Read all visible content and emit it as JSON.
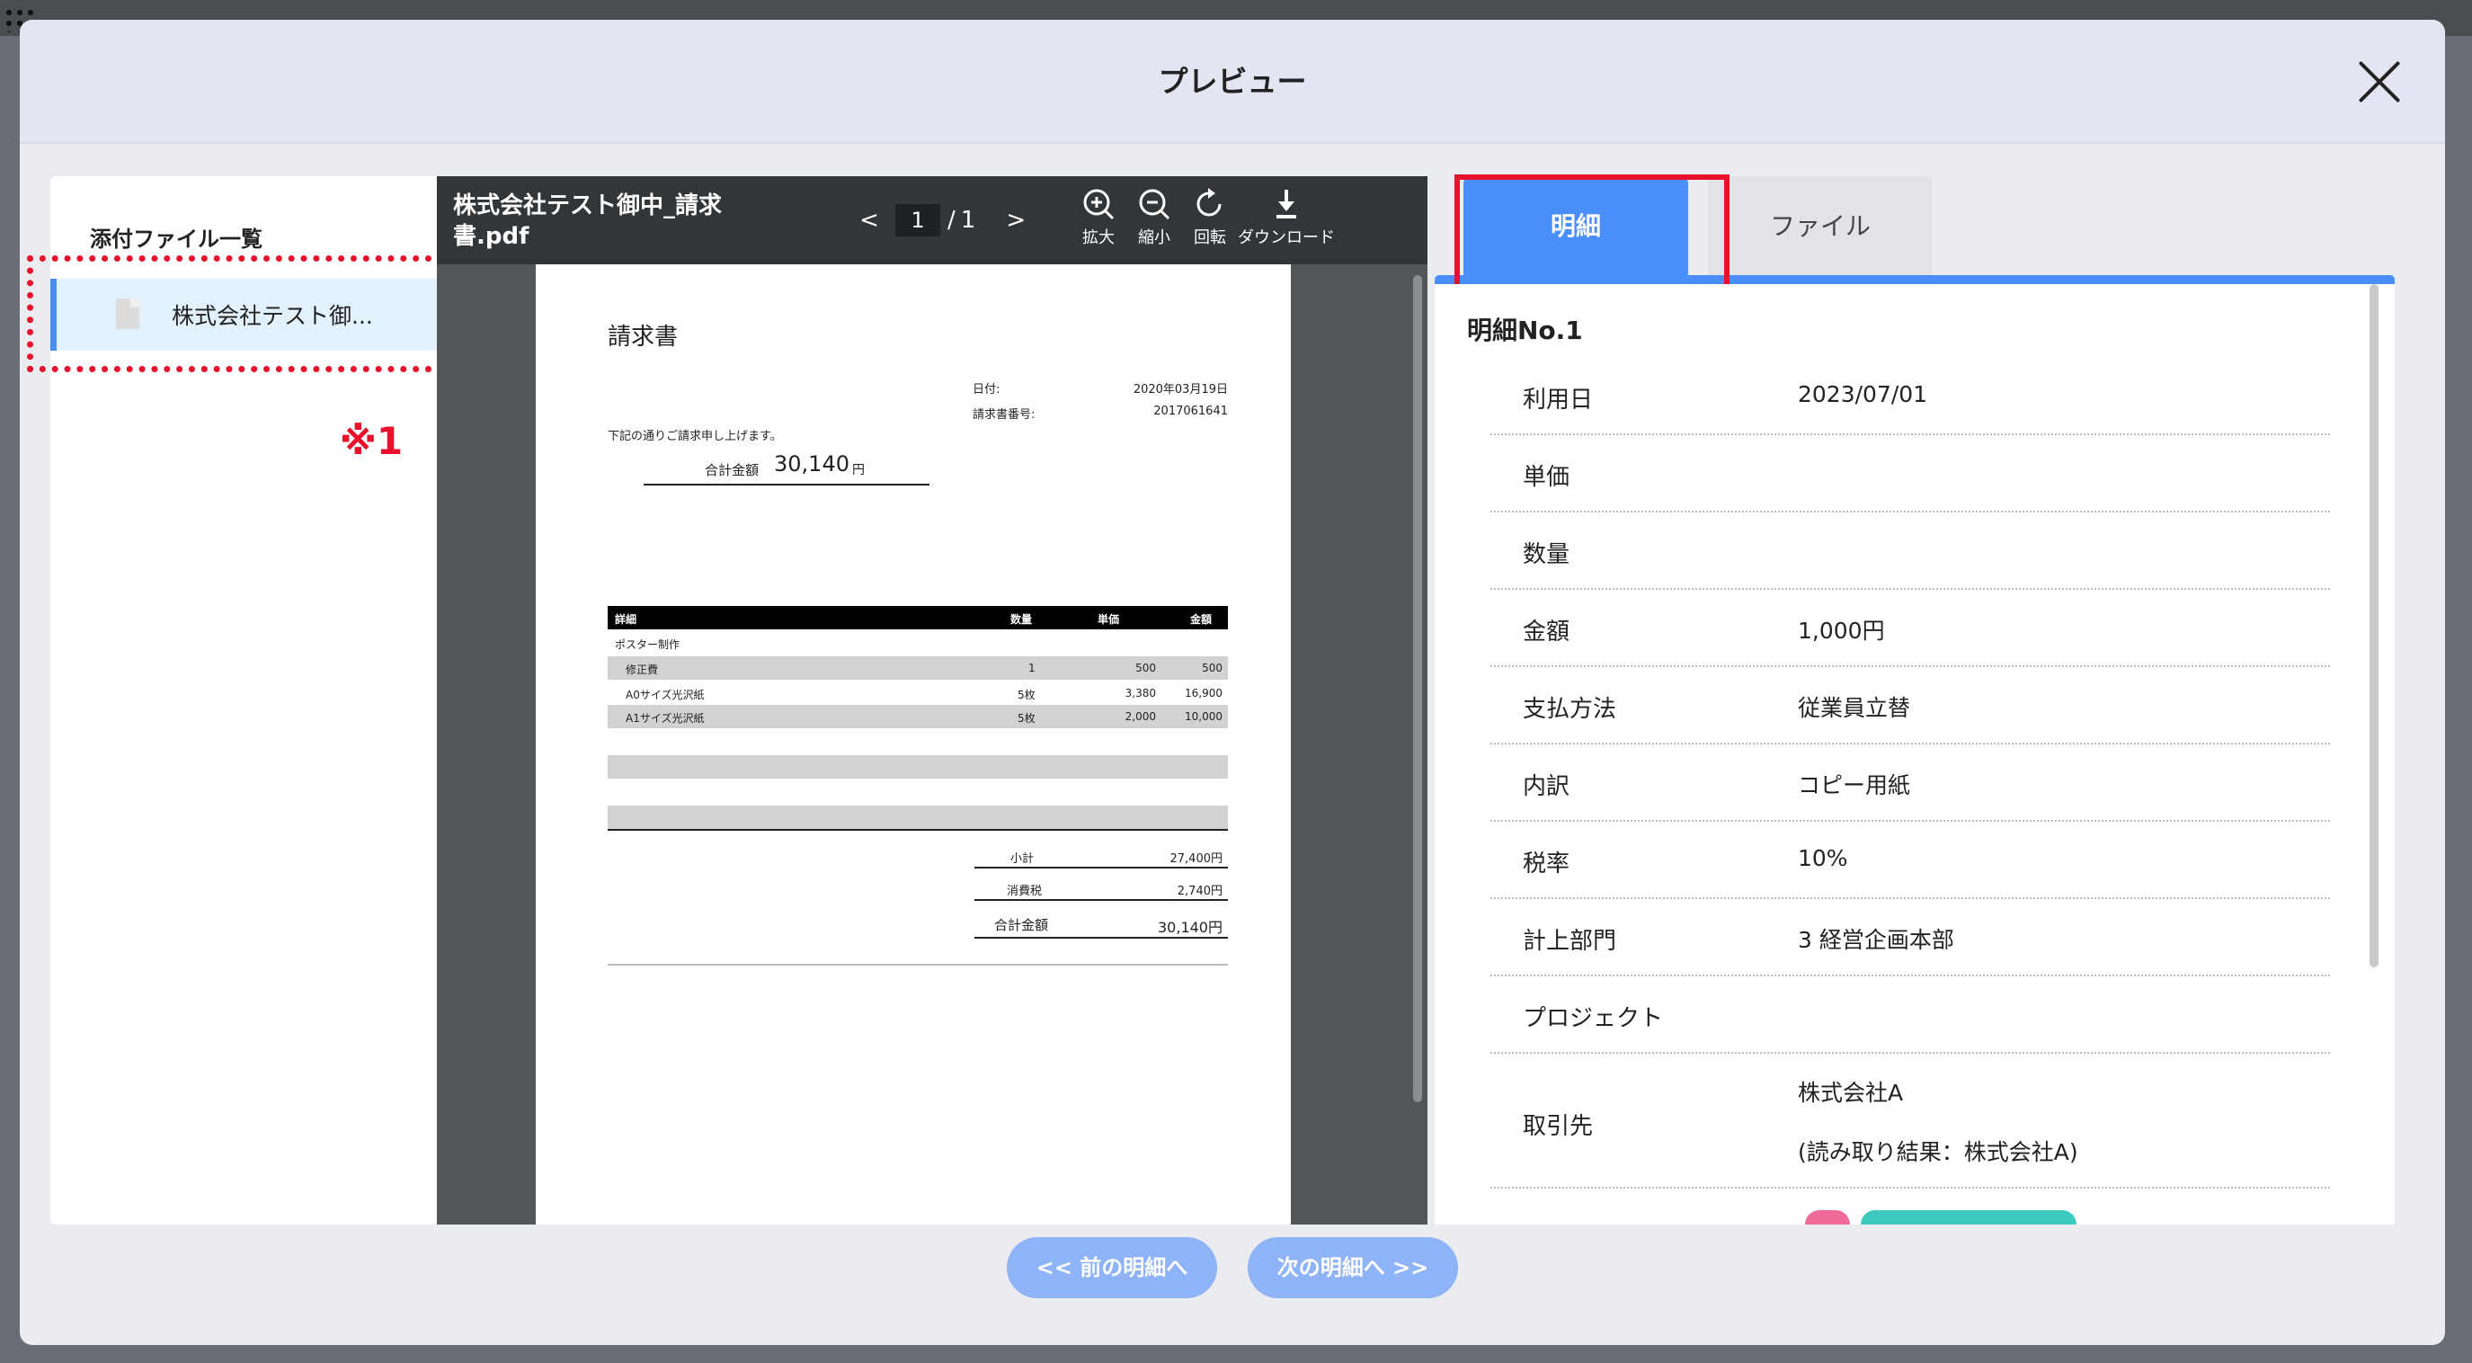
{
  "modal": {
    "title": "プレビュー"
  },
  "file_panel": {
    "title": "添付ファイル一覧",
    "files": [
      {
        "name": "株式会社テスト御..."
      }
    ],
    "note_mark": "※1"
  },
  "pdf_viewer": {
    "filename": "株式会社テスト御中_請求書.pdf",
    "page_current": "1",
    "page_separator": "/",
    "page_total": "1",
    "prev_glyph": "<",
    "next_glyph": ">",
    "tools": {
      "zoom_in": "拡大",
      "zoom_out": "縮小",
      "rotate": "回転",
      "download": "ダウンロード"
    },
    "invoice": {
      "title": "請求書",
      "date_label": "日付:",
      "date_value": "2020年03月19日",
      "number_label": "請求書番号:",
      "number_value": "2017061641",
      "greeting": "下記の通りご請求申し上げます。",
      "total_label": "合計金額",
      "total_value": "30,140",
      "total_unit": "円",
      "headers": [
        "詳細",
        "数量",
        "単価",
        "金額"
      ],
      "rows": [
        {
          "item": "ポスター制作",
          "qty": "",
          "unit": "",
          "amount": ""
        },
        {
          "item": "修正費",
          "qty": "1",
          "unit": "500",
          "amount": "500"
        },
        {
          "item": "A0サイズ光沢紙",
          "qty": "5枚",
          "unit": "3,380",
          "amount": "16,900"
        },
        {
          "item": "A1サイズ光沢紙",
          "qty": "5枚",
          "unit": "2,000",
          "amount": "10,000"
        }
      ],
      "subtotal_label": "小計",
      "subtotal_value": "27,400円",
      "tax_label": "消費税",
      "tax_value": "2,740円",
      "grand_label": "合計金額",
      "grand_value": "30,140円"
    }
  },
  "detail": {
    "tabs": {
      "meisai": "明細",
      "file": "ファイル"
    },
    "title": "明細No.1",
    "rows": [
      {
        "label": "利用日",
        "value": "2023/07/01"
      },
      {
        "label": "単価",
        "value": ""
      },
      {
        "label": "数量",
        "value": ""
      },
      {
        "label": "金額",
        "value": "1,000円"
      },
      {
        "label": "支払方法",
        "value": "従業員立替"
      },
      {
        "label": "内訳",
        "value": "コピー用紙"
      },
      {
        "label": "税率",
        "value": "10%"
      },
      {
        "label": "計上部門",
        "value": "3 経営企画本部"
      },
      {
        "label": "プロジェクト",
        "value": ""
      }
    ],
    "vendor": {
      "label": "取引先",
      "value": "株式会社A",
      "ocr": "(読み取り結果：株式会社A)"
    }
  },
  "nav": {
    "prev": "<< 前の明細へ",
    "next": "次の明細へ >>"
  },
  "colors": {
    "accent": "#4a8ef9",
    "highlight": "#e8102a",
    "nav_button": "#8eb3f7"
  }
}
